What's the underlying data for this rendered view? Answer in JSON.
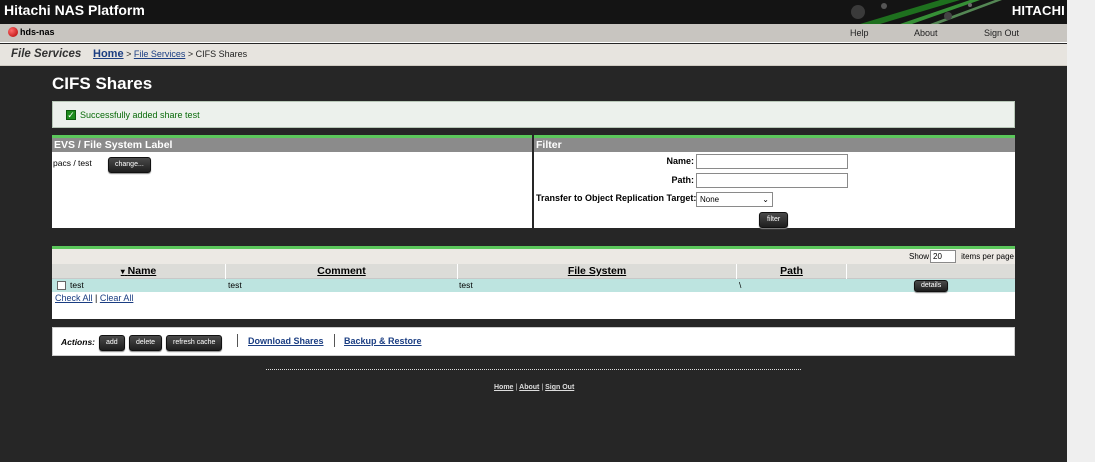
{
  "app": {
    "title": "Hitachi NAS Platform",
    "brand": "HITACHI"
  },
  "nav": {
    "host": "hds-nas",
    "help": "Help",
    "about": "About",
    "signout": "Sign Out"
  },
  "breadcrumb": {
    "section": "File Services",
    "home": "Home",
    "sep1": " > ",
    "file_services": "File Services",
    "sep2": " > ",
    "current": "CIFS Shares"
  },
  "page_title": "CIFS Shares",
  "message": {
    "text": "Successfully added share test"
  },
  "evs_panel": {
    "header": "EVS / File System Label",
    "value": "pacs /  test",
    "change_label": "change..."
  },
  "filter": {
    "header": "Filter",
    "name_label": "Name:",
    "path_label": "Path:",
    "transfer_label": "Transfer to Object Replication Target:",
    "transfer_value": "None",
    "filter_label": "filter"
  },
  "table": {
    "show_label": "Show",
    "per_page": "20",
    "items_label": "items per page",
    "sort_indicator": "▾",
    "headers": {
      "name": "Name",
      "comment": "Comment",
      "filesystem": "File System",
      "path": "Path"
    },
    "rows": [
      {
        "name": "test",
        "comment": "test",
        "filesystem": "test",
        "path": "\\",
        "details": "details"
      }
    ],
    "check_all": "Check All",
    "link_sep": " | ",
    "clear_all": "Clear All"
  },
  "actions": {
    "label": "Actions:",
    "add": "add",
    "delete": "delete",
    "refresh": "refresh cache",
    "download": "Download Shares",
    "backup": "Backup & Restore"
  },
  "footer": {
    "home": "Home",
    "sep": " | ",
    "about": "About",
    "signout": "Sign Out"
  }
}
